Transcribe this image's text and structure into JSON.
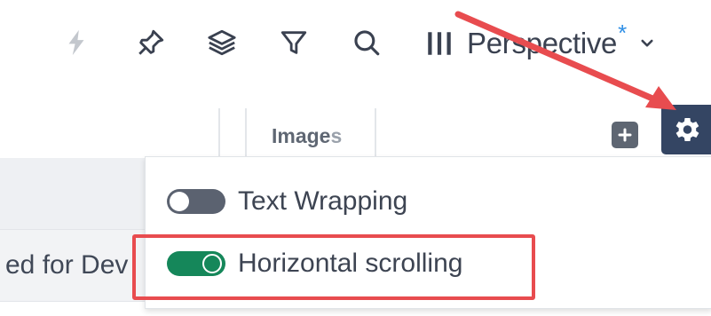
{
  "toolbar": {
    "icons": [
      "bolt-icon",
      "pin-icon",
      "layers-icon",
      "filter-icon",
      "search-icon"
    ],
    "perspective": {
      "label": "Perspective",
      "modified_marker": "*"
    }
  },
  "table": {
    "column_header": "Image",
    "column_header_faded": "s",
    "visible_row_text": "ed for Dev"
  },
  "settings_menu": {
    "options": [
      {
        "label": "Text Wrapping",
        "enabled": false
      },
      {
        "label": "Horizontal scrolling",
        "enabled": true
      }
    ]
  },
  "colors": {
    "accent_blue": "#2f8fe6",
    "gear_bg": "#344563",
    "toggle_on": "#15875a",
    "toggle_off": "#5b6270",
    "annotation_red": "#e84c4f"
  }
}
